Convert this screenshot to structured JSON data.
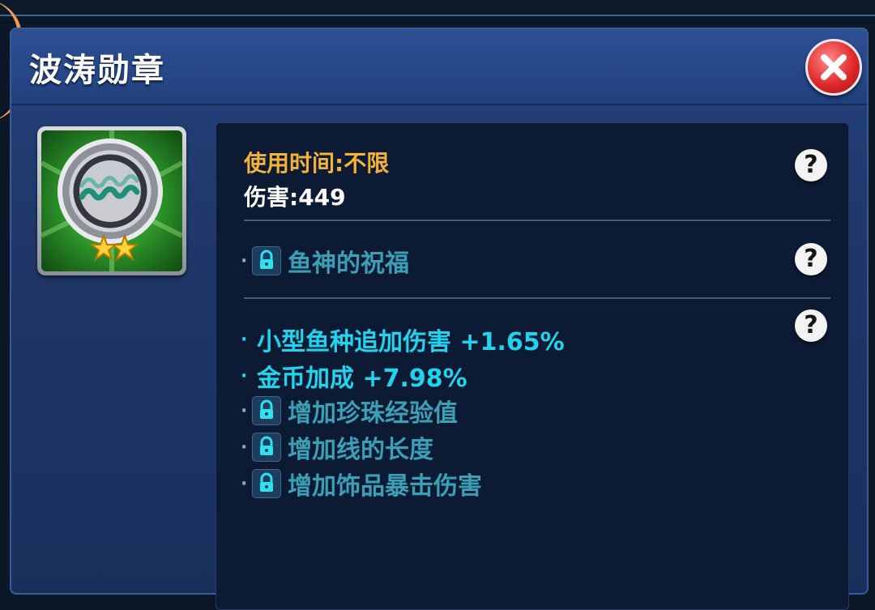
{
  "title": "波涛勋章",
  "badge": {
    "stars": 2,
    "icon": "wave-medal-icon"
  },
  "info": {
    "use_time": "使用时间:不限",
    "damage": "伤害:449"
  },
  "skill": {
    "name": "鱼神的祝福",
    "locked": true
  },
  "stats": [
    {
      "label": "小型鱼种追加伤害 +1.65%",
      "locked": false
    },
    {
      "label": "金币加成 +7.98%",
      "locked": false
    },
    {
      "label": "增加珍珠经验值",
      "locked": true
    },
    {
      "label": "增加线的长度",
      "locked": true
    },
    {
      "label": "增加饰品暴击伤害",
      "locked": true
    }
  ],
  "help_symbol": "?",
  "colors": {
    "use_time": "#f2b33a",
    "stat_active": "#22d3ee",
    "stat_locked": "#3b9fb6",
    "panel": "#1e3565"
  }
}
